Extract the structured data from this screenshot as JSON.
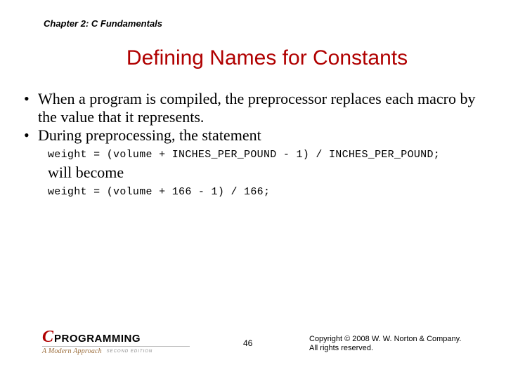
{
  "chapter": "Chapter 2: C Fundamentals",
  "title": "Defining Names for Constants",
  "bullets": {
    "b1": "When a program is compiled, the preprocessor replaces each macro by the value that it represents.",
    "b2": "During preprocessing, the statement"
  },
  "code1": "weight = (volume + INCHES_PER_POUND - 1) /  INCHES_PER_POUND;",
  "inter": "will become",
  "code2": "weight = (volume + 166 - 1) / 166;",
  "logo": {
    "c": "C",
    "prog": "PROGRAMMING",
    "sub": "A Modern Approach",
    "ed": "SECOND EDITION"
  },
  "pagenum": "46",
  "copyright_line1": "Copyright © 2008 W. W. Norton & Company.",
  "copyright_line2": "All rights reserved."
}
